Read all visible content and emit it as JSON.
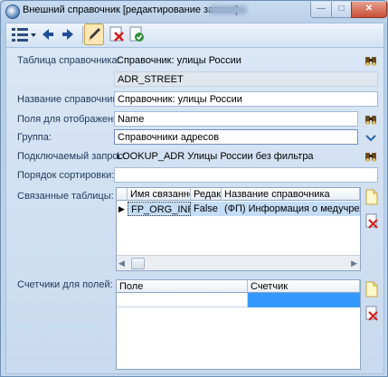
{
  "window": {
    "title": "Внешний справочник [редактирование записи]",
    "minimize_glyph": "—",
    "maximize_glyph": "□",
    "close_glyph": "✕"
  },
  "colors": {
    "selection": "#3399ff",
    "row_highlight": "#c4ddf6",
    "label_text": "#1e395b"
  },
  "form": {
    "table": {
      "label": "Таблица справочника:",
      "value": "Справочник: улицы России",
      "db_name": "ADR_STREET"
    },
    "name": {
      "label": "Название справочника:",
      "value": "Справочник: улицы России"
    },
    "fields": {
      "label": "Поля для отображения:",
      "value": "Name"
    },
    "group": {
      "label": "Группа:",
      "value": "Справочники адресов"
    },
    "query": {
      "label": "Подключаемый запрос:",
      "value": "LOOKUP_ADR Улицы России без фильтра"
    },
    "sort": {
      "label": "Порядок сортировки:",
      "value": ""
    },
    "related": {
      "label": "Связанные таблицы:",
      "columns": [
        "Имя связанной",
        "Редакт",
        "Название справочника"
      ],
      "rows": [
        {
          "marker": "▶",
          "cells": [
            "FP_ORG_INFO",
            "False",
            "(ФП) Информация о медучреждении"
          ]
        }
      ]
    },
    "counters": {
      "label": "Счетчики для полей:",
      "columns": [
        "Поле",
        "Счетчик"
      ],
      "rows": [
        {
          "cells": [
            "",
            ""
          ]
        }
      ]
    }
  }
}
